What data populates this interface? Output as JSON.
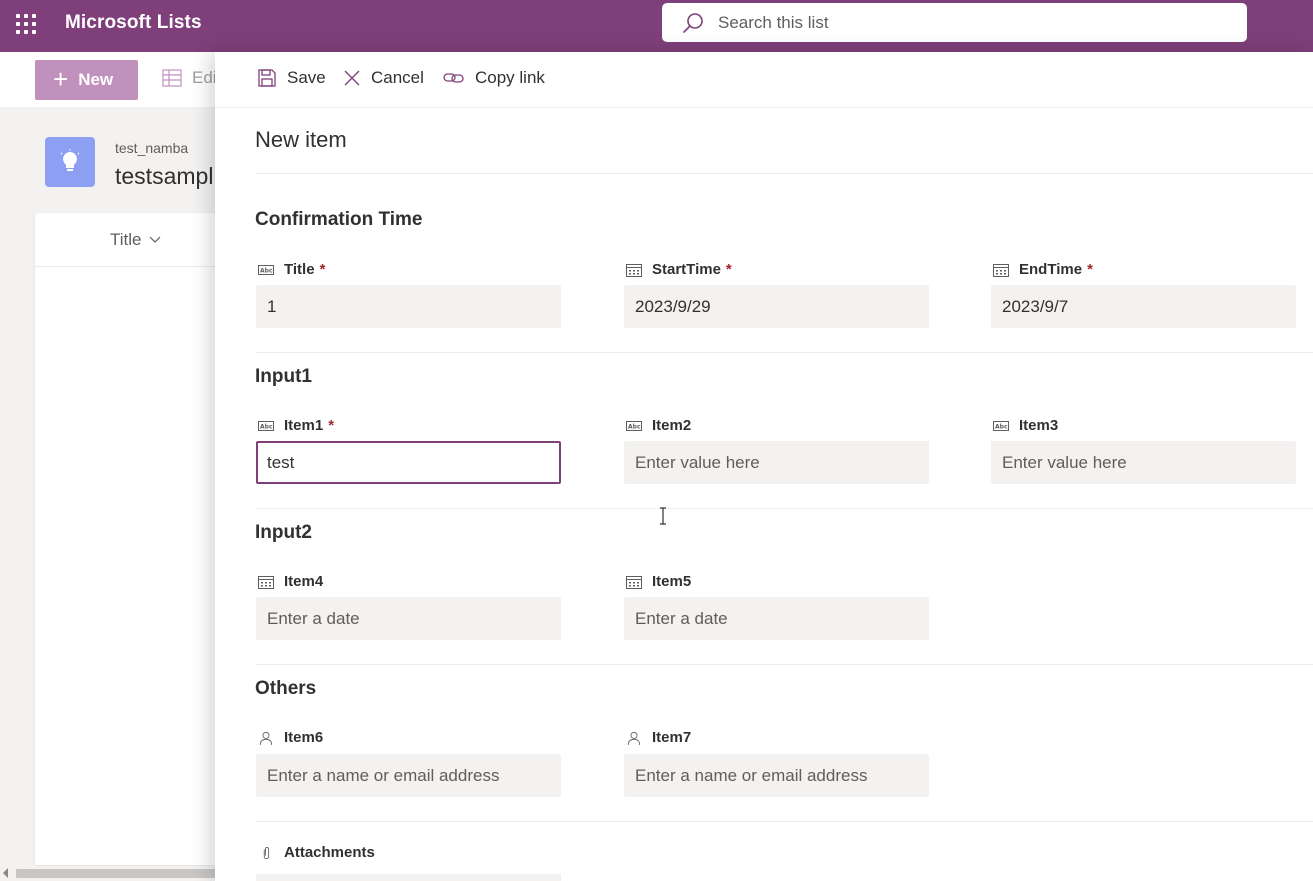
{
  "suite": {
    "app_title": "Microsoft Lists",
    "search_placeholder": "Search this list"
  },
  "background": {
    "new_label": "New",
    "edit_label": "Edi",
    "list_owner": "test_namba",
    "list_name": "testsampl",
    "column_title": "Title"
  },
  "toolbar": {
    "save_label": "Save",
    "cancel_label": "Cancel",
    "copy_link_label": "Copy link"
  },
  "panel_title": "New item",
  "sections": {
    "confirmation": {
      "title": "Confirmation Time",
      "title_field": {
        "label": "Title",
        "required": "*",
        "value": "1"
      },
      "start_field": {
        "label": "StartTime",
        "required": "*",
        "value": "2023/9/29"
      },
      "end_field": {
        "label": "EndTime",
        "required": "*",
        "value": "2023/9/7"
      }
    },
    "input1": {
      "title": "Input1",
      "item1": {
        "label": "Item1",
        "required": "*",
        "value": "test"
      },
      "item2": {
        "label": "Item2",
        "placeholder": "Enter value here"
      },
      "item3": {
        "label": "Item3",
        "placeholder": "Enter value here"
      }
    },
    "input2": {
      "title": "Input2",
      "item4": {
        "label": "Item4",
        "placeholder": "Enter a date"
      },
      "item5": {
        "label": "Item5",
        "placeholder": "Enter a date"
      }
    },
    "others": {
      "title": "Others",
      "item6": {
        "label": "Item6",
        "placeholder": "Enter a name or email address"
      },
      "item7": {
        "label": "Item7",
        "placeholder": "Enter a name or email address"
      }
    },
    "attachments": {
      "label": "Attachments"
    }
  },
  "colors": {
    "accent": "#7f3f7a",
    "required": "#a4262c",
    "new_button": "#c191be"
  }
}
